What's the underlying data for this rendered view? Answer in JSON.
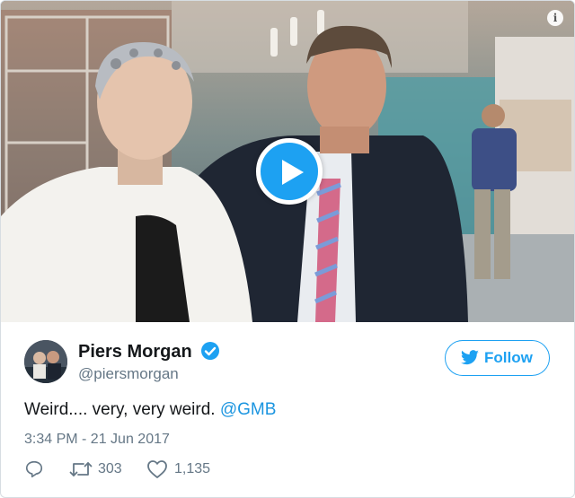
{
  "media": {
    "icons": [
      "info-icon",
      "play-icon"
    ]
  },
  "tweet": {
    "display_name": "Piers Morgan",
    "handle": "@piersmorgan",
    "verified": true,
    "follow_label": "Follow",
    "text": "Weird.... very, very weird. ",
    "mention": "@GMB",
    "timestamp": "3:34 PM - 21 Jun 2017",
    "retweet_count": "303",
    "like_count": "1,135"
  },
  "colors": {
    "accent": "#1da1f2",
    "mention": "#1b95e0",
    "muted": "#657786",
    "text": "#14171a"
  }
}
